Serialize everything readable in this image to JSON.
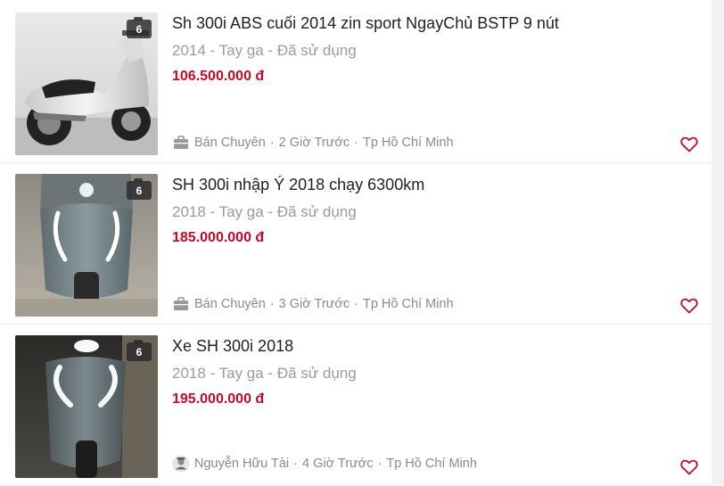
{
  "listings": [
    {
      "title": "Sh 300i ABS cuối 2014 zin sport NgayChủ BSTP 9 nút",
      "meta": "2014 - Tay ga - Đã sử dụng",
      "price": "106.500.000 đ",
      "photo_count": "6",
      "seller_icon": "briefcase-icon",
      "seller": "Bán Chuyên",
      "time": "2 Giờ Trước",
      "location": "Tp Hồ Chí Minh"
    },
    {
      "title": "SH 300i nhập Ý 2018 chạy 6300km",
      "meta": "2018 - Tay ga - Đã sử dụng",
      "price": "185.000.000 đ",
      "photo_count": "6",
      "seller_icon": "briefcase-icon",
      "seller": "Bán Chuyên",
      "time": "3 Giờ Trước",
      "location": "Tp Hồ Chí Minh"
    },
    {
      "title": "Xe SH 300i 2018",
      "meta": "2018 - Tay ga - Đã sử dụng",
      "price": "195.000.000 đ",
      "photo_count": "6",
      "seller_icon": "user-avatar-icon",
      "seller": "Nguyễn Hữu Tài",
      "time": "4 Giờ Trước",
      "location": "Tp Hồ Chí Minh"
    }
  ],
  "separator": "·",
  "colors": {
    "price": "#c90927",
    "title": "#222222",
    "meta": "#9b9b9b",
    "heart": "#c90927"
  }
}
